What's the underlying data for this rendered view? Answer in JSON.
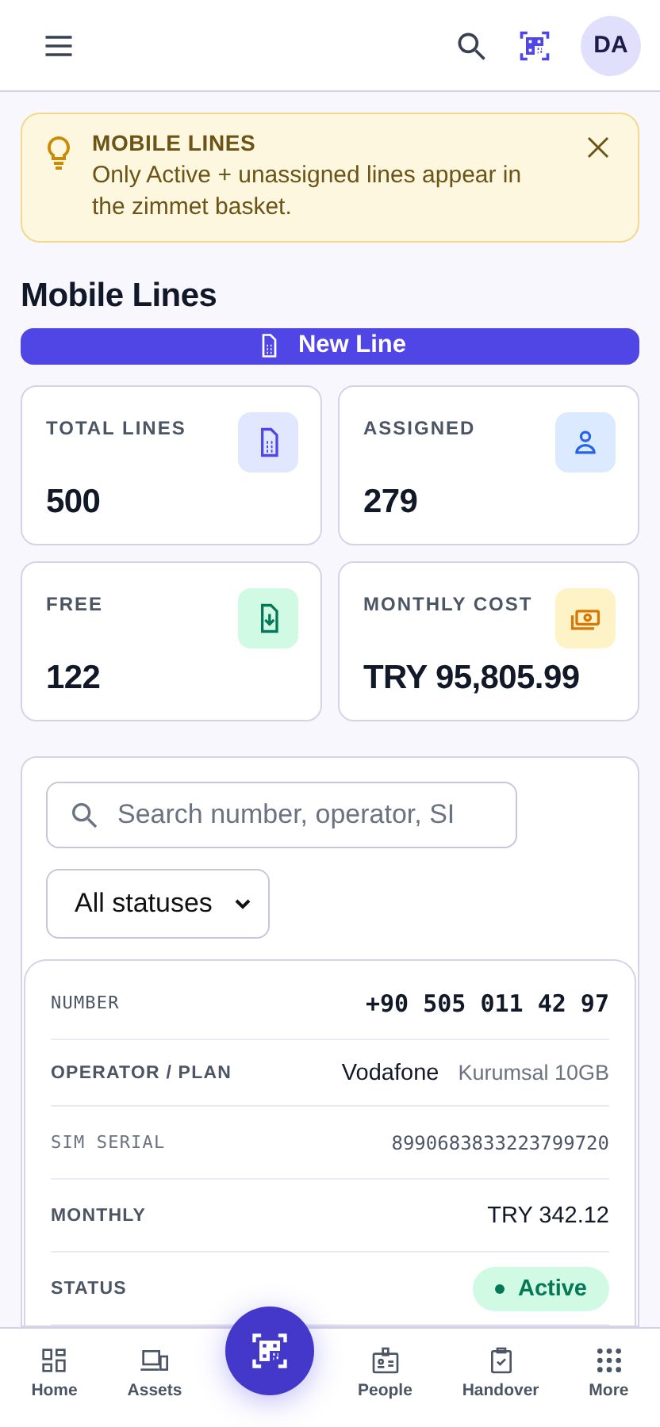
{
  "header": {
    "avatar": "DA"
  },
  "notice": {
    "title": "MOBILE LINES",
    "text": "Only Active + unassigned lines appear in the zimmet basket."
  },
  "page_title": "Mobile Lines",
  "new_button": "New Line",
  "stats": [
    {
      "label": "TOTAL LINES",
      "value": "500",
      "kind": "sim"
    },
    {
      "label": "ASSIGNED",
      "value": "279",
      "kind": "person"
    },
    {
      "label": "FREE",
      "value": "122",
      "kind": "free"
    },
    {
      "label": "MONTHLY COST",
      "value": "TRY 95,805.99",
      "kind": "cost"
    }
  ],
  "search": {
    "placeholder": "Search number, operator, SI"
  },
  "status_filter": {
    "value": "All statuses"
  },
  "line": [
    {
      "kind": "number",
      "label": "NUMBER",
      "value": "+90 505 011 42 97"
    },
    {
      "kind": "operator",
      "label": "OPERATOR / PLAN",
      "value": "Vodafone",
      "plan": "Kurumsal 10GB"
    },
    {
      "kind": "serial",
      "label": "SIM SERIAL",
      "value": "8990683833223799720"
    },
    {
      "kind": "plain",
      "label": "MONTHLY",
      "value": "TRY 342.12"
    },
    {
      "kind": "status",
      "label": "STATUS",
      "value": "Active"
    }
  ],
  "nav": [
    {
      "label": "Home",
      "kind": "home"
    },
    {
      "label": "Assets",
      "kind": "assets"
    },
    {
      "kind": "scan"
    },
    {
      "label": "People",
      "kind": "people"
    },
    {
      "label": "Handover",
      "kind": "handover"
    },
    {
      "label": "More",
      "kind": "more"
    }
  ]
}
